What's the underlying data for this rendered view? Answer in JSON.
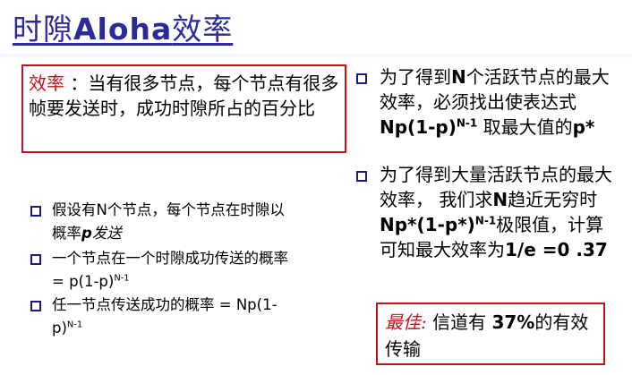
{
  "title": {
    "prefix": "时隙",
    "latin": "Aloha",
    "suffix": "效率"
  },
  "definition": {
    "keyword": "效率",
    "sep": " ：",
    "text": "当有很多节点，每个节点有很多帧要发送时，成功时隙所占的百分比"
  },
  "left_bullets": [
    {
      "a": "假设有",
      "b": "N",
      "c": "个节点，每个节点在时隙以概率",
      "d": "p",
      "e": "发送"
    },
    {
      "a": "一个节点在一个时隙成功传送的概率 ",
      "b": "= p(1-p)",
      "sup": "N-1"
    },
    {
      "a": "任一节点传送成功的概率 ",
      "b": "= Np(1-p)",
      "sup": "N-1"
    }
  ],
  "right_bullets": [
    {
      "a": "为了得到",
      "b": "N",
      "c": "个活跃节点的最大效率，必须找出使表达式",
      "d": "Np(1-p)",
      "sup": "N-1",
      "e": " 取最大值的",
      "f": "p*"
    },
    {
      "a": "为了得到大量活跃节点的最大效率， 我们求",
      "b": "N",
      "c": "趋近无穷时",
      "d": "Np*(1-p*)",
      "sup": "N-1",
      "e": "极限值，计算可知最大效率为",
      "f": "1/e =0 .37"
    }
  ],
  "best": {
    "label": "最佳",
    "colon": ":",
    "text_a": " 信道有 ",
    "value": "37%",
    "text_b": "的有效传输"
  },
  "colors": {
    "title": "#2a2a9a",
    "accent": "#c0141c",
    "bullet": "#1a1a80"
  },
  "icons": {
    "bullet": "hollow-square-bullet-icon"
  }
}
